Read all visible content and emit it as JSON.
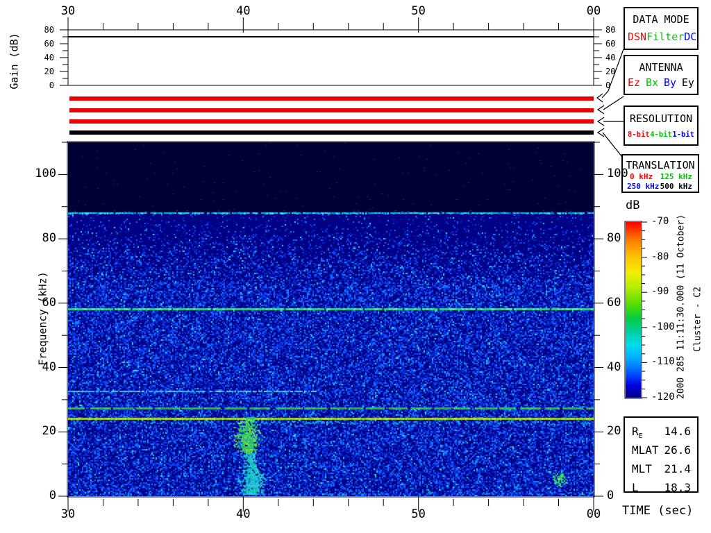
{
  "gain_plot": {
    "ylabel": "Gain (dB)",
    "yticks": [
      0,
      20,
      40,
      60,
      80
    ],
    "ylim": [
      0,
      80
    ],
    "gain_line_db": 70
  },
  "time_axis": {
    "label": "TIME (sec)",
    "ticks": [
      "30",
      "40",
      "50",
      "00"
    ],
    "minor_step_sec": 2
  },
  "status_bars": [
    {
      "name": "data-mode-bar",
      "color": "#ee0000",
      "meaning": "DSN"
    },
    {
      "name": "antenna-bar",
      "color": "#ee0000",
      "meaning": "Ez"
    },
    {
      "name": "resolution-bar",
      "color": "#ee0000",
      "meaning": "8-bit"
    },
    {
      "name": "translation-bar",
      "color": "#000000",
      "meaning": "500 kHz"
    }
  ],
  "panels": {
    "data_mode": {
      "title": "DATA MODE",
      "options": [
        {
          "label": "DSN",
          "color": "#ff0000"
        },
        {
          "label": "Filter",
          "color": "#00c800"
        },
        {
          "label": "DC",
          "color": "#0000ff"
        }
      ]
    },
    "antenna": {
      "title": "ANTENNA",
      "options": [
        {
          "label": "Ez",
          "color": "#ff0000"
        },
        {
          "label": "Bx",
          "color": "#00c800"
        },
        {
          "label": "By",
          "color": "#0000ff"
        },
        {
          "label": "Ey",
          "color": "#000000"
        }
      ]
    },
    "resolution": {
      "title": "RESOLUTION",
      "options": [
        {
          "label": "8-bit",
          "color": "#ff0000"
        },
        {
          "label": "4-bit",
          "color": "#00c800"
        },
        {
          "label": "1-bit",
          "color": "#0000ff"
        }
      ]
    },
    "translation": {
      "title": "TRANSLATION",
      "options": [
        {
          "label": "0 kHz",
          "color": "#ff0000"
        },
        {
          "label": "125 kHz",
          "color": "#00c800"
        },
        {
          "label": "250 kHz",
          "color": "#0000ff"
        },
        {
          "label": "500 kHz",
          "color": "#000000"
        }
      ]
    }
  },
  "side_text": {
    "datetime": "2000 285 11:11:30.000 (11 October)",
    "spacecraft": "Cluster - C2"
  },
  "info_table": {
    "rows": [
      {
        "label": "R",
        "sub": "E",
        "value": "14.6"
      },
      {
        "label": "MLAT",
        "sub": "",
        "value": "26.6"
      },
      {
        "label": "MLT",
        "sub": "",
        "value": "21.4"
      },
      {
        "label": "L",
        "sub": "",
        "value": "18.3"
      }
    ]
  },
  "chart_data": {
    "type": "heatmap",
    "title": "Cluster C2 WBD wideband spectrogram",
    "xlabel": "TIME (sec)",
    "x_ticks": [
      "30",
      "40",
      "50",
      "00"
    ],
    "x_start_sec": 30,
    "x_span_sec": 30,
    "ylabel": "Frequency (kHz)",
    "ylim": [
      0,
      110
    ],
    "y_major_ticks": [
      0,
      20,
      40,
      60,
      80,
      100
    ],
    "y_minor_ticks": [
      10,
      30,
      50,
      70,
      90,
      110
    ],
    "colorbar": {
      "label": "dB",
      "min": -120,
      "max": -70,
      "major_ticks": [
        -70,
        -80,
        -90,
        -100,
        -110,
        -120
      ],
      "minor_step": 2.5
    },
    "noise": {
      "dark_above_khz": 88,
      "sparse_band_khz": [
        66,
        88
      ],
      "dense_below_khz": 66,
      "floor_db": [
        -120,
        -108
      ]
    },
    "features": [
      {
        "kind": "line",
        "freq_khz": 88,
        "t_sec": [
          30,
          60
        ],
        "color": "cyan",
        "level_db": -108
      },
      {
        "kind": "interference_dashes",
        "freq_khz": 66,
        "period_sec": 1,
        "color": "blue",
        "level_db": -114
      },
      {
        "kind": "line",
        "freq_khz": 58,
        "t_sec": [
          30,
          60
        ],
        "color": "green",
        "level_db": -96
      },
      {
        "kind": "line",
        "freq_khz": 50,
        "t_sec": [
          30,
          60
        ],
        "color": "faint-cyan-dotted",
        "level_db": -112
      },
      {
        "kind": "line",
        "freq_khz": 32.5,
        "t_sec": [
          30,
          44.3
        ],
        "color": "cyan",
        "level_db": -106
      },
      {
        "kind": "line",
        "freq_khz": 27.5,
        "t_sec": [
          30,
          60
        ],
        "color": "green",
        "dashed": true,
        "level_db": -92
      },
      {
        "kind": "line",
        "freq_khz": 24,
        "t_sec": [
          30,
          60
        ],
        "color": "yellow-green",
        "level_db": -84
      },
      {
        "kind": "burst",
        "t_sec": [
          39.7,
          41.0
        ],
        "freq_khz": [
          0.5,
          24.5
        ],
        "color": "green-cyan",
        "level_db": -90
      },
      {
        "kind": "spot",
        "t_sec": [
          57.6,
          58.4
        ],
        "freq_khz": [
          3,
          7.5
        ],
        "color": "green",
        "level_db": -98
      },
      {
        "kind": "edge_noise",
        "freq_khz": [
          0,
          1.5
        ],
        "color": "cyan",
        "level_db": -106
      }
    ]
  }
}
